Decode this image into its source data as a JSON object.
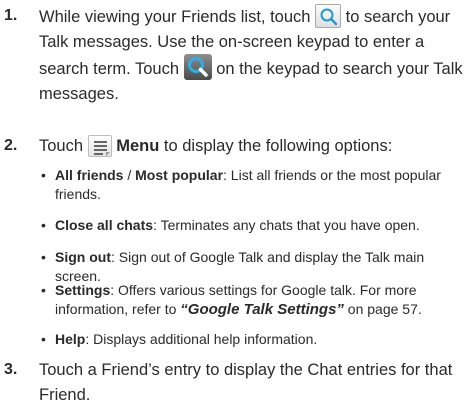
{
  "step1": {
    "number": "1.",
    "text_a": "While viewing your Friends list, touch",
    "text_b": "to search your Talk messages. Use the on-screen keypad to enter a search term. Touch",
    "text_c": "on the keypad to search your Talk messages.",
    "icon1": "search-icon",
    "icon2": "search-key-icon"
  },
  "step2": {
    "number": "2.",
    "text_a": "Touch",
    "menu_label": "Menu",
    "text_b": "to display the following options:",
    "icon": "menu-icon",
    "options": [
      {
        "bullet": "•",
        "term": "All friends",
        "sep": " / ",
        "term2": "Most popular",
        "desc": ": List all friends or the most popular friends."
      },
      {
        "bullet": "•",
        "term": "Close all chats",
        "desc": ": Terminates any chats that you have open."
      },
      {
        "bullet": "•",
        "term": "Sign out",
        "desc": ": Sign out of Google Talk and display the Talk main screen."
      },
      {
        "bullet": "•",
        "term": "Settings",
        "desc": ": Offers various settings for Google talk. For more information, refer to ",
        "ref": "“Google Talk Settings”",
        "page": " on page 57."
      },
      {
        "bullet": "•",
        "term": "Help",
        "desc": ": Displays additional help information."
      }
    ]
  },
  "step3": {
    "number": "3.",
    "text": "Touch a Friend’s entry to display the Chat entries for that Friend."
  }
}
